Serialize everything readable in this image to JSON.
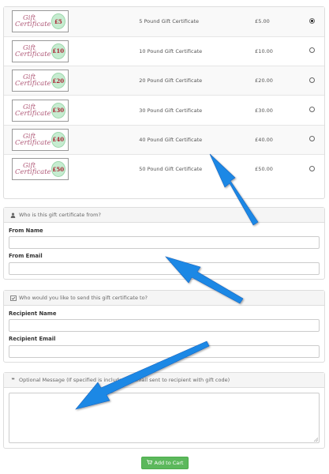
{
  "certificates": [
    {
      "gc_line1": "Gift",
      "gc_line2": "Certificate",
      "badge": "£5",
      "description": "5 Pound Gift Certificate",
      "price": "£5.00",
      "selected": true
    },
    {
      "gc_line1": "Gift",
      "gc_line2": "Certificate",
      "badge": "£10",
      "description": "10 Pound Gift Certificate",
      "price": "£10.00",
      "selected": false
    },
    {
      "gc_line1": "Gift",
      "gc_line2": "Certificate",
      "badge": "£20",
      "description": "20 Pound Gift Certificate",
      "price": "£20.00",
      "selected": false
    },
    {
      "gc_line1": "Gift",
      "gc_line2": "Certificate",
      "badge": "£30",
      "description": "30 Pound Gift Certificate",
      "price": "£30.00",
      "selected": false
    },
    {
      "gc_line1": "Gift",
      "gc_line2": "Certificate",
      "badge": "£40",
      "description": "40 Pound Gift Certificate",
      "price": "£40.00",
      "selected": false
    },
    {
      "gc_line1": "Gift",
      "gc_line2": "Certificate",
      "badge": "£50",
      "description": "50 Pound Gift Certificate",
      "price": "£50.00",
      "selected": false
    }
  ],
  "from_section": {
    "icon": "user-icon",
    "heading": "Who is this gift certificate from?",
    "name_label": "From Name",
    "name_value": "",
    "email_label": "From Email",
    "email_value": ""
  },
  "to_section": {
    "icon": "envelope-check-icon",
    "heading": "Who would you like to send this gift certificate to?",
    "name_label": "Recipient Name",
    "name_value": "",
    "email_label": "Recipient Email",
    "email_value": ""
  },
  "message_section": {
    "icon": "quote-icon",
    "heading": "Optional Message (If specified is included in email sent to recipient with gift code)",
    "message_value": ""
  },
  "add_to_cart": {
    "label": "Add to Cart",
    "icon": "cart-icon",
    "color": "#5cb85c"
  },
  "annotation_color": "#1e88e5"
}
